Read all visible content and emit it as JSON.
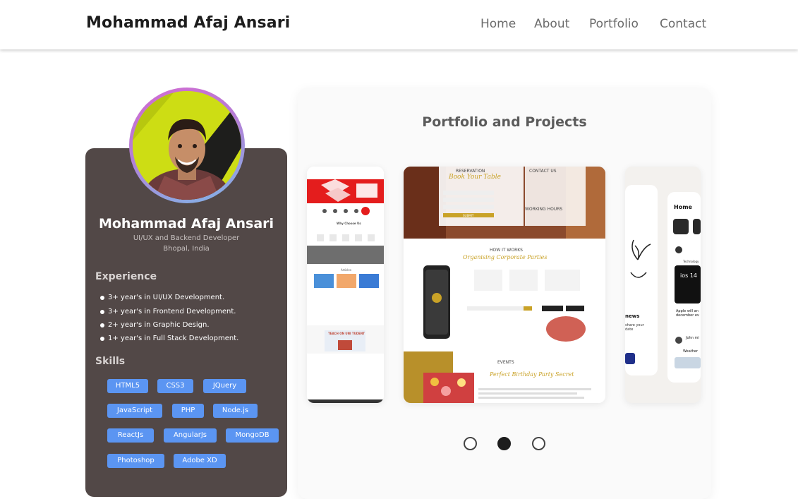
{
  "header": {
    "brand": "Mohammad Afaj Ansari",
    "nav": [
      "Home",
      "About",
      "Portfolio",
      "Contact"
    ]
  },
  "profile": {
    "name": "Mohammad Afaj Ansari",
    "role": "UI/UX and Backend Developer",
    "location": "Bhopal, India",
    "experience_title": "Experience",
    "experience": [
      "3+ year's in UI/UX Development.",
      "3+ year's in Frontend Development.",
      "2+ year's in Graphic Design.",
      "1+ year's in Full Stack Development."
    ],
    "skills_title": "Skills",
    "skills": [
      "HTML5",
      "CSS3",
      "JQuery",
      "JavaScript",
      "PHP",
      "Node.js",
      "ReactJs",
      "AngularJs",
      "MongoDB",
      "Photoshop",
      "Adobe XD"
    ]
  },
  "portfolio": {
    "title": "Portfolio and Projects",
    "slide_center": {
      "reservation": "RESERVATION",
      "book_table": "Book Your Table",
      "contact_us": "CONTACT US",
      "working_hours": "WORKING HOURS",
      "submit": "SUBMIT",
      "how_it_works": "HOW IT WORKS",
      "organising": "Organising Corporate Parties",
      "events": "EVENTS",
      "birthday": "Perfect Birthday Party Secret"
    },
    "slide_left": {
      "why_choose": "Why Choose Us",
      "articles": "Articles",
      "teach": "TEACH ON UNI TUDENT"
    },
    "slide_right": {
      "home": "Home",
      "news": "news",
      "share": "share your",
      "date": "date",
      "technology": "Technology",
      "ios": "ios 14",
      "apple": "Apple will an",
      "december": "december ev",
      "john": "John mi",
      "weather": "Weather"
    },
    "active_slide": 2,
    "slide_count": 3
  }
}
